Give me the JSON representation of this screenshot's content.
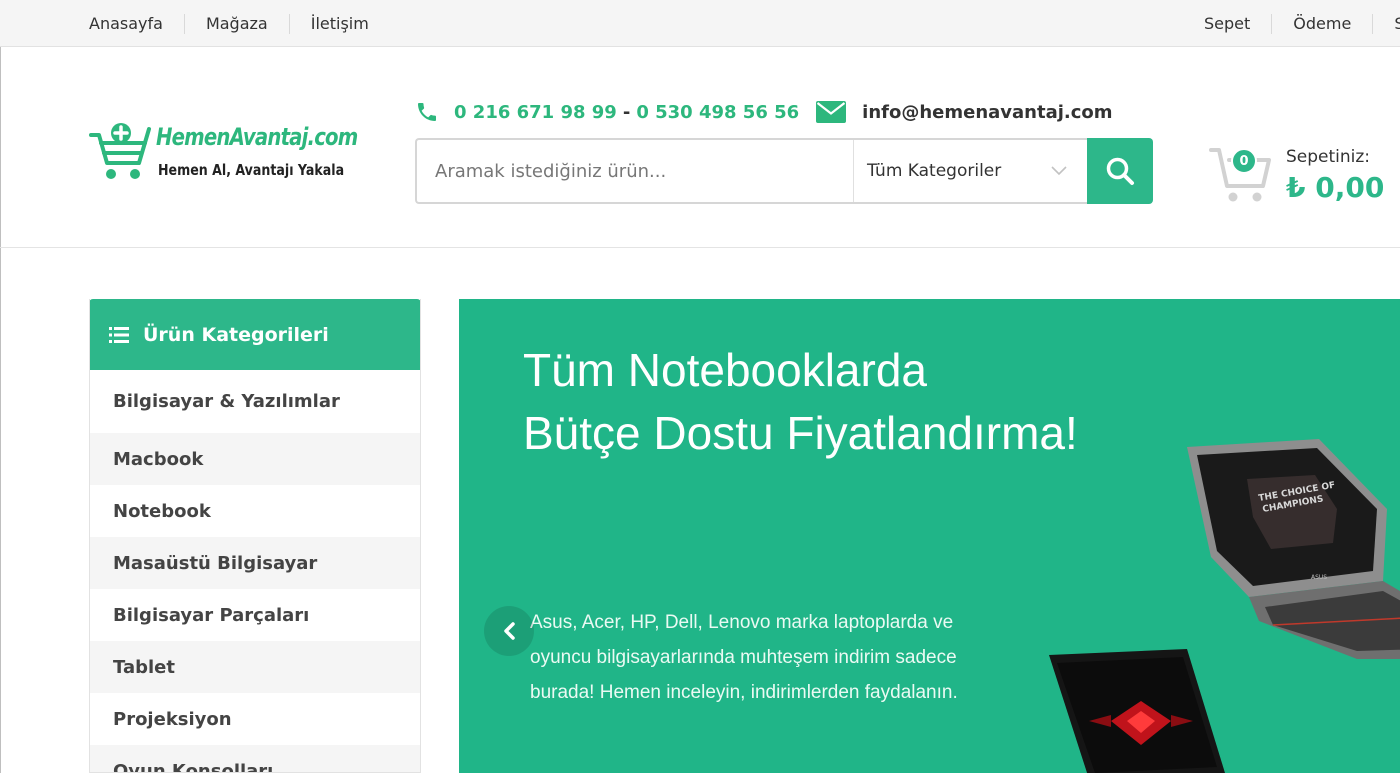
{
  "topbar": {
    "left_links": [
      "Anasayfa",
      "Mağaza",
      "İletişim"
    ],
    "right_links": [
      "Sepet",
      "Ödeme",
      "S"
    ]
  },
  "logo": {
    "name": "HemenAvantaj.com",
    "slogan": "Hemen Al, Avantajı Yakala"
  },
  "contact": {
    "phone1": "0 216 671 98 99",
    "separator": "-",
    "phone2": "0 530 498 56 56",
    "email": "info@hemenavantaj.com"
  },
  "search": {
    "placeholder": "Aramak istediğiniz ürün...",
    "category": "Tüm Kategoriler"
  },
  "cart": {
    "count": "0",
    "label": "Sepetiniz:",
    "total": "₺ 0,00"
  },
  "sidebar": {
    "title": "Ürün Kategorileri",
    "items": [
      "Bilgisayar & Yazılımlar",
      "Macbook",
      "Notebook",
      "Masaüstü Bilgisayar",
      "Bilgisayar Parçaları",
      "Tablet",
      "Projeksiyon",
      "Oyun Konsolları"
    ]
  },
  "hero": {
    "title_line1": "Tüm Notebooklarda",
    "title_line2": "Bütçe Dostu Fiyatlandırma!",
    "text": "Asus, Acer, HP, Dell, Lenovo marka laptoplarda ve oyuncu bilgisayarlarında muhteşem indirim sadece burada! Hemen inceleyin, indirimlerden faydalanın.",
    "laptop_screen_text_line1": "THE CHOICE OF",
    "laptop_screen_text_line2": "CHAMPIONS",
    "laptop_brand": "ASUS"
  },
  "colors": {
    "accent": "#2db78a",
    "hero_bg": "#20b588",
    "topbar_bg": "#f5f5f5"
  },
  "icons": [
    "phone-icon",
    "envelope-icon",
    "search-icon",
    "chevron-down-icon",
    "cart-icon",
    "list-icon",
    "chevron-left-icon",
    "logo-cart-icon"
  ]
}
